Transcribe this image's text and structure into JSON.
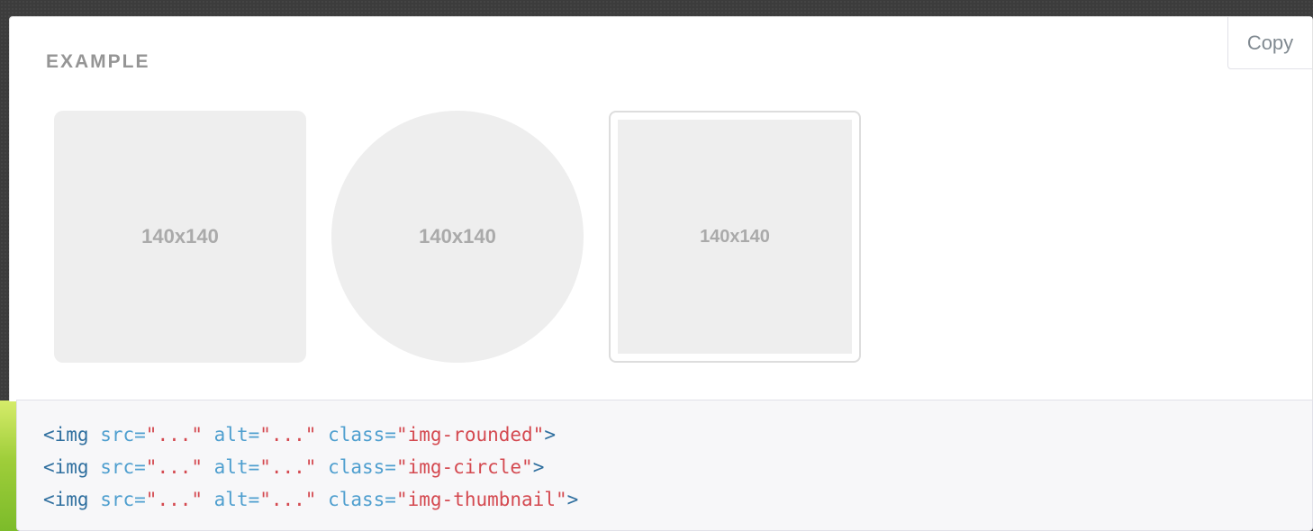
{
  "example": {
    "label": "EXAMPLE",
    "copy_label": "Copy",
    "placeholders": [
      {
        "text": "140x140",
        "shape": "rounded"
      },
      {
        "text": "140x140",
        "shape": "circle"
      },
      {
        "text": "140x140",
        "shape": "thumbnail"
      }
    ]
  },
  "code": {
    "lines": [
      {
        "open": "<img",
        "src_attr": " src=",
        "src_val": "\"...\"",
        "alt_attr": " alt=",
        "alt_val": "\"...\"",
        "class_attr": " class=",
        "class_val": "\"img-rounded\"",
        "close": ">"
      },
      {
        "open": "<img",
        "src_attr": " src=",
        "src_val": "\"...\"",
        "alt_attr": " alt=",
        "alt_val": "\"...\"",
        "class_attr": " class=",
        "class_val": "\"img-circle\"",
        "close": ">"
      },
      {
        "open": "<img",
        "src_attr": " src=",
        "src_val": "\"...\"",
        "alt_attr": " alt=",
        "alt_val": "\"...\"",
        "class_attr": " class=",
        "class_val": "\"img-thumbnail\"",
        "close": ">"
      }
    ]
  },
  "colors": {
    "page_background": "#3c3c3c",
    "code_tag": "#2f6f9f",
    "code_attr": "#4f9fcf",
    "code_string": "#d44950",
    "placeholder_fill": "#eeeeee"
  }
}
